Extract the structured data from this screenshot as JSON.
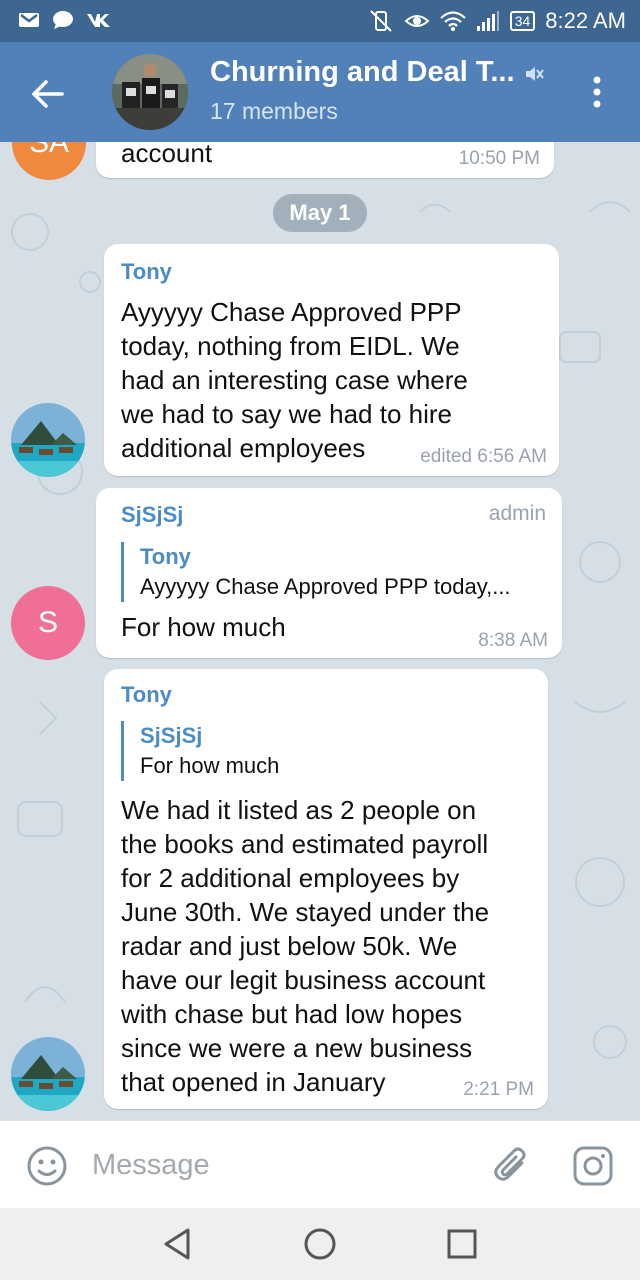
{
  "status_bar": {
    "time": "8:22 AM",
    "battery": "34",
    "left_icons": [
      "gmail-icon",
      "chat-icon",
      "vk-icon"
    ],
    "right_icons": [
      "vibrate-off-icon",
      "eye-icon",
      "wifi-icon",
      "signal-icon",
      "battery-icon"
    ]
  },
  "header": {
    "title": "Churning and Deal T...",
    "subtitle": "17 members",
    "muted": true
  },
  "messages": [
    {
      "avatar_initials": "SA",
      "avatar_color": "#f0883e",
      "text": "account",
      "time": "10:50 PM"
    }
  ],
  "date_separator": "May 1",
  "message_tony_1": {
    "sender": "Tony",
    "lines": [
      "Ayyyyy Chase Approved PPP",
      "today, nothing from EIDL. We",
      "had an interesting case where",
      "we had to say we had to hire",
      "additional employees"
    ],
    "time": "edited 6:56 AM"
  },
  "message_sjsjsj": {
    "sender": "SjSjSj",
    "badge": "admin",
    "reply_name": "Tony",
    "reply_text": "Ayyyyy Chase Approved PPP today,...",
    "text": "For how much",
    "time": "8:38 AM",
    "avatar_initial": "S",
    "avatar_color": "#ef6f96"
  },
  "message_tony_2": {
    "sender": "Tony",
    "reply_name": "SjSjSj",
    "reply_text": "For how much",
    "lines": [
      "We had it listed as 2 people on",
      "the books and estimated payroll",
      "for 2 additional employees by",
      "June 30th. We stayed under the",
      "radar and just below 50k. We",
      "have our legit business account",
      "with chase but had low hopes",
      "since we were a new business",
      "that opened in January"
    ],
    "time": "2:21 PM"
  },
  "input": {
    "placeholder": "Message"
  },
  "colors": {
    "header": "#5181b8",
    "status_bar": "#3d6690",
    "accent": "#4b8cc4",
    "background": "#d6dfe6"
  }
}
